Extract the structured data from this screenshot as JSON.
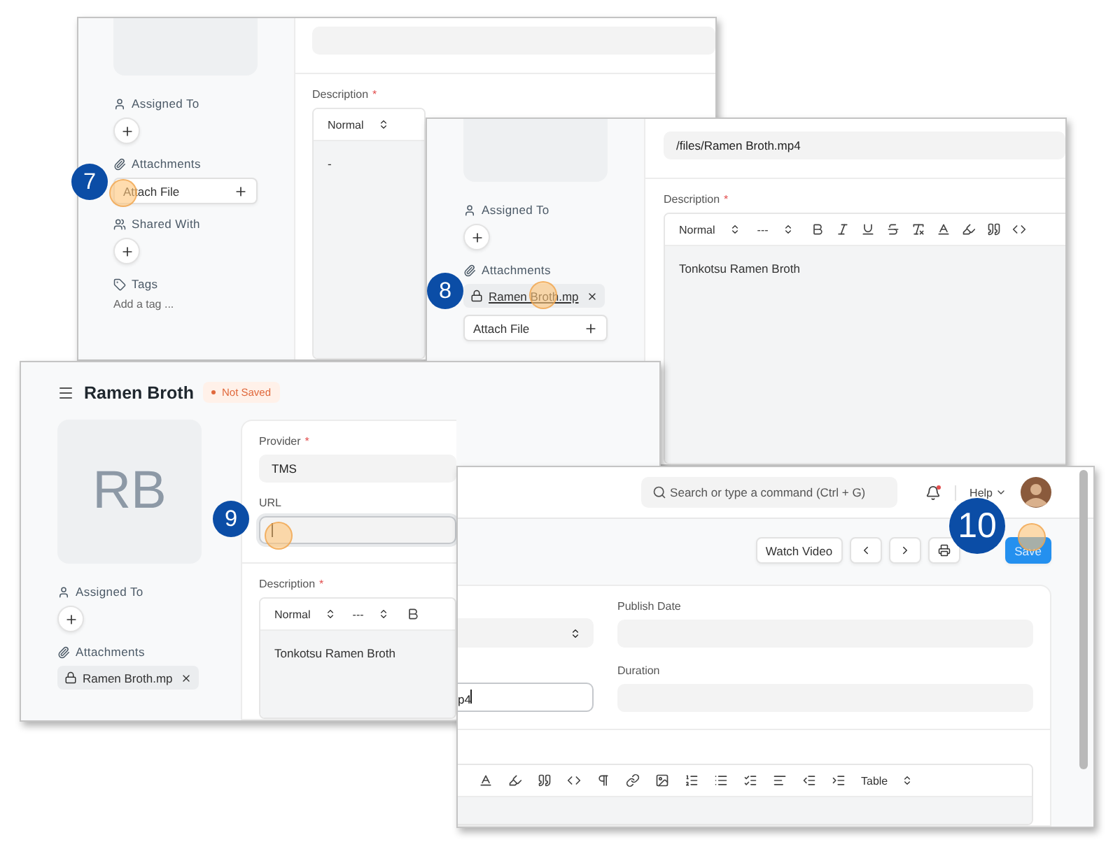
{
  "step7_window": {
    "step": "7",
    "sidebar": [
      {
        "kind": "assigned",
        "label": "Assigned To"
      },
      {
        "kind": "attachments",
        "label": "Attachments",
        "attach_label": "Attach File"
      },
      {
        "kind": "shared",
        "label": "Shared With"
      },
      {
        "kind": "tags",
        "label": "Tags",
        "add_label": "Add a tag ..."
      }
    ],
    "description": {
      "label": "Description",
      "required_mark": "*",
      "selects": [
        "Normal"
      ],
      "content": "-"
    }
  },
  "step8_window": {
    "step": "8",
    "sidebar": [
      {
        "kind": "assigned",
        "label": "Assigned To"
      },
      {
        "kind": "attachments",
        "label": "Attachments",
        "files": [
          {
            "name": "Ramen Broth.mp",
            "hovered": true
          }
        ],
        "attach_label": "Attach File"
      }
    ],
    "url_field": {
      "value": "/files/Ramen Broth.mp4"
    },
    "description": {
      "label": "Description",
      "required_mark": "*",
      "selects": [
        "Normal",
        "---"
      ],
      "content": "Tonkotsu Ramen Broth"
    }
  },
  "step9_window": {
    "step": "9",
    "title": "Ramen Broth",
    "status": "Not Saved",
    "avatar_initials": "RB",
    "sidebar": [
      {
        "kind": "assigned",
        "label": "Assigned To"
      },
      {
        "kind": "attachments",
        "label": "Attachments",
        "files": [
          {
            "name": "Ramen Broth.mp",
            "hovered": false
          }
        ]
      }
    ],
    "fields": [
      {
        "label": "Provider",
        "required_mark": "*",
        "value": "TMS",
        "focused": false
      },
      {
        "label": "URL",
        "focused": true
      }
    ],
    "description": {
      "label": "Description",
      "required_mark": "*",
      "selects": [
        "Normal",
        "---"
      ],
      "content": "Tonkotsu Ramen Broth"
    }
  },
  "step10_window": {
    "step": "10",
    "search": {
      "placeholder": "Search or type a command (Ctrl + G)"
    },
    "notification_unread": true,
    "help_label": "Help",
    "watch_video_label": "Watch Video",
    "save_label": "Save",
    "left_fields": [
      {
        "kind": "select",
        "focused": false
      },
      {
        "kind": "text",
        "value": "p4",
        "focused": true
      }
    ],
    "right_fields": [
      {
        "label": "Publish Date"
      },
      {
        "label": "Duration"
      }
    ],
    "toolbar_selects": [
      "Table"
    ]
  }
}
